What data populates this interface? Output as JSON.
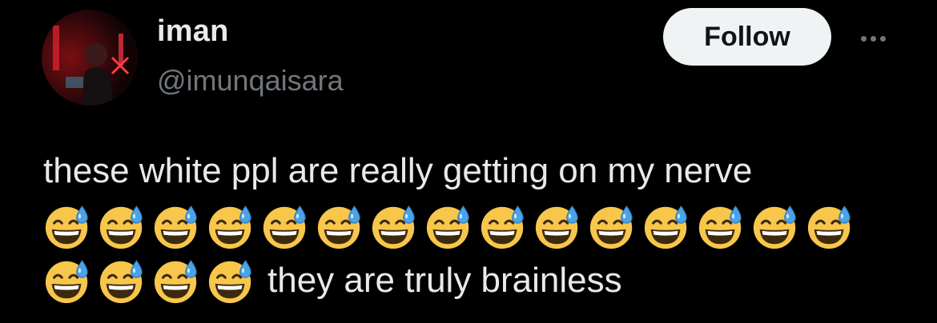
{
  "author": {
    "display_name": "iman",
    "handle": "@imunqaisara"
  },
  "actions": {
    "follow_label": "Follow",
    "more_icon": "more-horizontal-icon"
  },
  "tweet": {
    "text_line": "these white ppl are really getting on my nerve",
    "emoji_name": "grinning-face-with-sweat-emoji",
    "emoji_line1_count": 15,
    "emoji_line2_count": 4,
    "trailing_text": "they are truly brainless"
  },
  "colors": {
    "background": "#000000",
    "primary_text": "#e7e9ea",
    "secondary_text": "#71767b",
    "follow_button_bg": "#eff3f4",
    "emoji_face": "#f7c64b"
  }
}
